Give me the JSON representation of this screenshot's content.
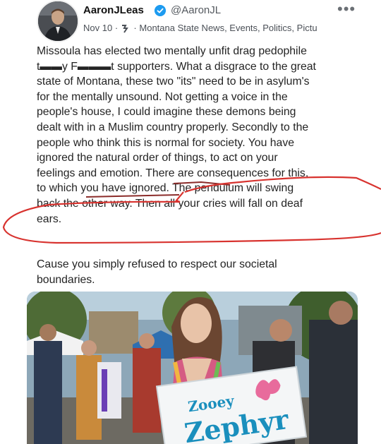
{
  "post": {
    "author": {
      "display_name": "AaronJLeas",
      "handle": "@AaronJL",
      "avatar_icon": "user-avatar-photo",
      "verified_icon": "verified-badge-icon"
    },
    "meta": {
      "date": "Nov 10",
      "separator": "·",
      "icon": "tags-icon",
      "tags": "Montana State News, Events, Politics, Pictu"
    },
    "more_icon": "more-horizontal-icon",
    "more_label": "•••",
    "body": "Missoula has elected two mentally unfit drag pedophile\nt▬▬y F▬▬▬t supporters. What a disgrace to the great\nstate of Montana, these two \"its\" need to be in asylum's\nfor the mentally unsound. Not getting a voice in the\npeople's house, I could imagine these demons being\ndealt with in a Muslim country properly. Secondly to the\npeople who think this is normal for society. You have\nignored the natural order of things, to act on your\nfeelings and emotion. There are consequences for this,\nto which you have ignored. The pendulum will swing\nback the other way. Then all your cries will fall on deaf\nears.",
    "closing": "Cause you simply refused to respect our societal\nboundaries.",
    "image": {
      "sign_line1": "Zooey",
      "sign_line2": "Zephyr"
    }
  },
  "colors": {
    "verified": "#1d9bf0",
    "annotation": "#d8332f",
    "sign_blue": "#1a8fbd",
    "shirt_blue": "#4f8fd6"
  }
}
